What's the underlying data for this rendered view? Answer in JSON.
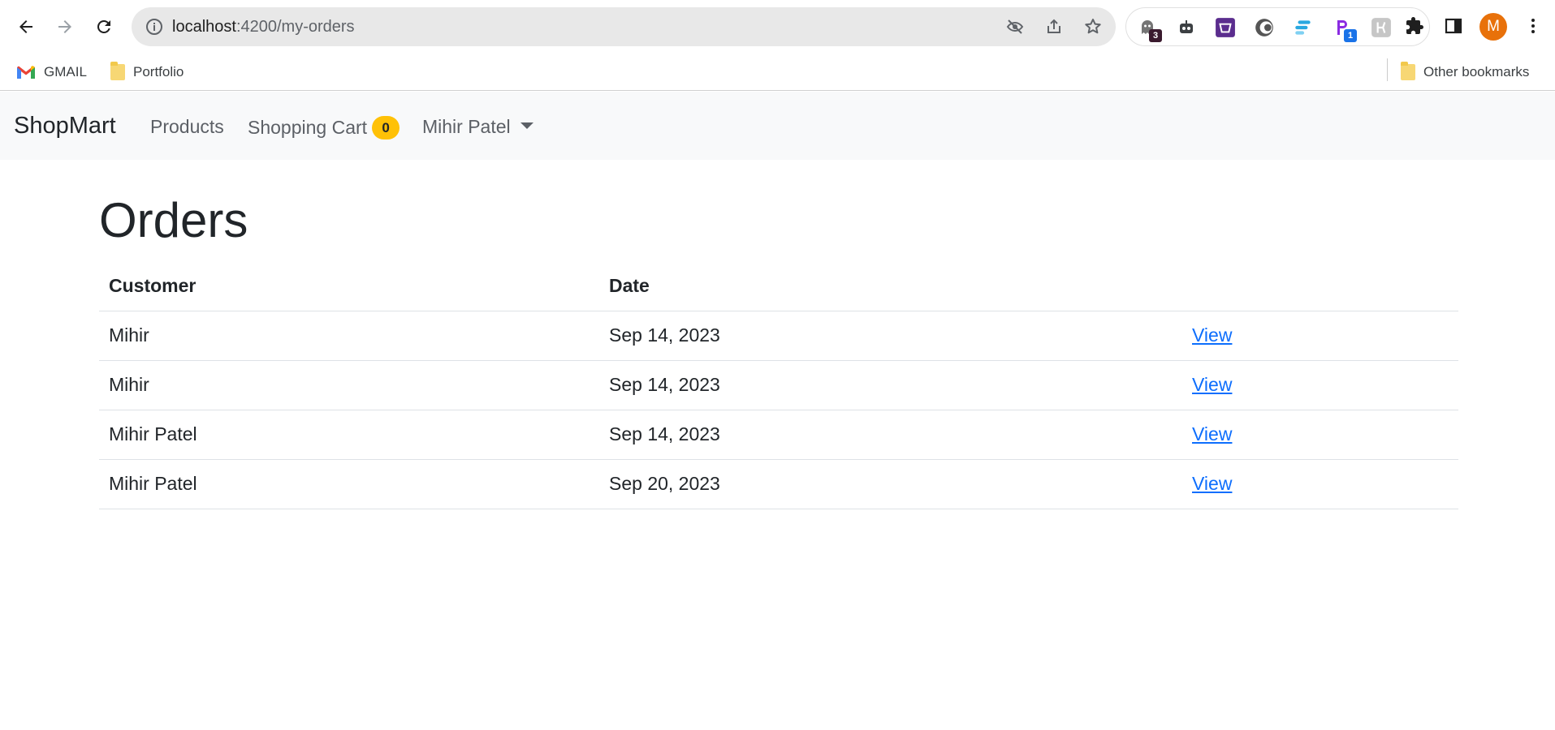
{
  "browser": {
    "url_host": "localhost",
    "url_rest": ":4200/my-orders",
    "extensions": [
      {
        "icon": "ghost-extension-icon",
        "badge": "3",
        "badge_color": "#3a1a2e"
      },
      {
        "icon": "robot-extension-icon"
      },
      {
        "icon": "basket-extension-icon",
        "color": "#5b2d8e"
      },
      {
        "icon": "wave-extension-icon"
      },
      {
        "icon": "bars-extension-icon",
        "color": "#29a8e0"
      },
      {
        "icon": "p-extension-icon",
        "badge": "1",
        "badge_color": "#1a73e8"
      },
      {
        "icon": "gray-extension-icon"
      }
    ],
    "avatar_letter": "M"
  },
  "bookmarks": {
    "items": [
      {
        "label": "GMAIL",
        "icon": "gmail-icon"
      },
      {
        "label": "Portfolio",
        "icon": "folder-icon"
      }
    ],
    "other": "Other bookmarks"
  },
  "navbar": {
    "brand": "ShopMart",
    "products": "Products",
    "cart": "Shopping Cart",
    "cart_count": "0",
    "user": "Mihir Patel",
    "badge_color": "#ffc107"
  },
  "page": {
    "title": "Orders",
    "columns": [
      "Customer",
      "Date",
      ""
    ],
    "rows": [
      {
        "customer": "Mihir",
        "date": "Sep 14, 2023",
        "action": "View"
      },
      {
        "customer": "Mihir",
        "date": "Sep 14, 2023",
        "action": "View"
      },
      {
        "customer": "Mihir Patel",
        "date": "Sep 14, 2023",
        "action": "View"
      },
      {
        "customer": "Mihir Patel",
        "date": "Sep 20, 2023",
        "action": "View"
      }
    ],
    "link_color": "#0d6efd"
  }
}
